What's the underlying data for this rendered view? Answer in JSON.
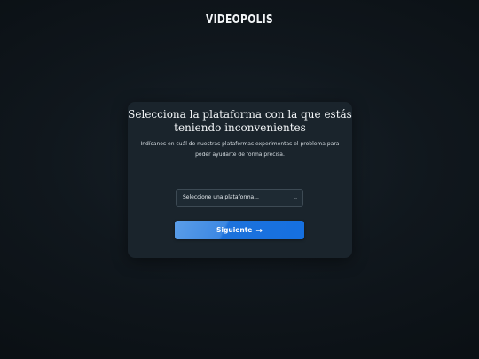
{
  "header": {
    "logo_text": "VIDEOPOLIS"
  },
  "card": {
    "title_line1": "Selecciona la plataforma con la que estás",
    "title_line2": "teniendo inconvenientes",
    "description_line1": "Indícanos en cuál de nuestras plataformas experimentas el problema para",
    "description_line2": "poder ayudarte de forma precisa.",
    "select": {
      "selected_value": "Seleccione una plataforma...",
      "chevron_icon": "chevron-down-icon"
    },
    "next_button": {
      "label": "Siguiente",
      "icon": "arrow-right-icon",
      "colors": [
        "#5b9ee8",
        "#1570e0"
      ]
    }
  },
  "colors": {
    "background": "#0f161b",
    "card": "#1a242c",
    "accent": "#1570e0"
  }
}
